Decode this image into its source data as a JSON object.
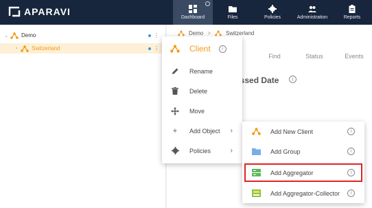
{
  "app": {
    "logo_text": "APARAVI",
    "accent_color": "#f39a1a",
    "nav_color": "#17263c"
  },
  "nav": [
    {
      "label": "Dashboard",
      "icon": "dashboard-icon",
      "active": true
    },
    {
      "label": "Files",
      "icon": "folder-icon",
      "active": false
    },
    {
      "label": "Policies",
      "icon": "gear-icon",
      "active": false
    },
    {
      "label": "Administration",
      "icon": "users-icon",
      "active": false
    },
    {
      "label": "Reports",
      "icon": "clipboard-icon",
      "active": false
    }
  ],
  "tree": {
    "items": [
      {
        "label": "Demo",
        "expanded": true
      },
      {
        "label": "Switzerland",
        "selected": true
      }
    ]
  },
  "breadcrumb": [
    "Demo",
    "Switzerland"
  ],
  "tabs": [
    "Find",
    "Status",
    "Events"
  ],
  "section": {
    "title": "essed Date"
  },
  "context_menu": {
    "title": "Client",
    "items": [
      {
        "label": "Rename",
        "icon": "pencil-icon"
      },
      {
        "label": "Delete",
        "icon": "trash-icon"
      },
      {
        "label": "Move",
        "icon": "move-icon"
      },
      {
        "label": "Add Object",
        "icon": "plus-icon",
        "submenu": true
      },
      {
        "label": "Policies",
        "icon": "gear-icon",
        "submenu": true
      }
    ]
  },
  "submenu": {
    "items": [
      {
        "label": "Add New Client",
        "icon": "client-icon"
      },
      {
        "label": "Add Group",
        "icon": "folder-icon"
      },
      {
        "label": "Add Aggregator",
        "icon": "aggregator-icon",
        "highlighted": true
      },
      {
        "label": "Add Aggregator-Collector",
        "icon": "aggregator-collector-icon"
      }
    ]
  }
}
